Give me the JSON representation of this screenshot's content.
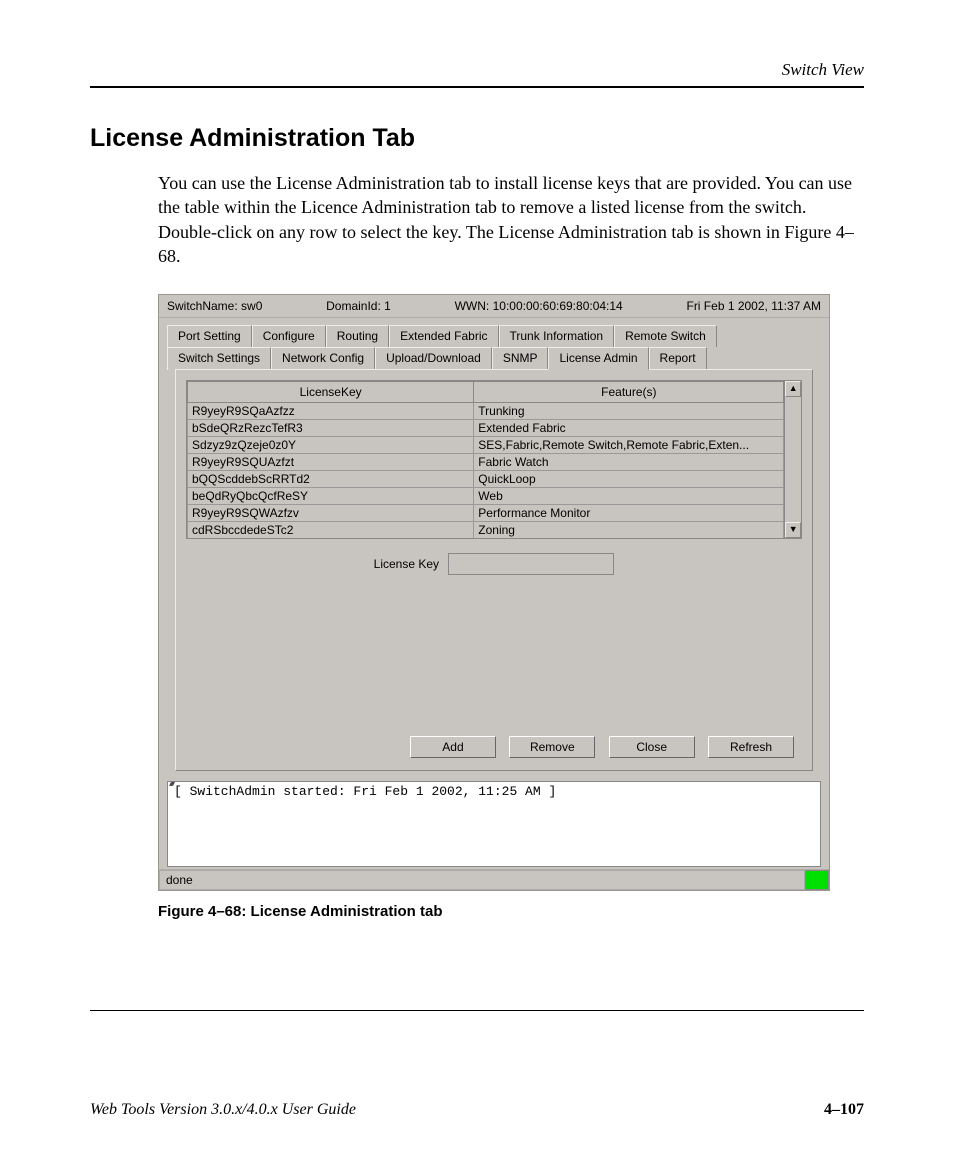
{
  "page_header": "Switch View",
  "heading": "License Administration Tab",
  "intro": "You can use the License Administration tab to install license keys that are provided. You can use the table within the Licence Administration tab to remove a listed license from the switch. Double-click on any row to select the key. The License Administration tab is shown in Figure 4–68.",
  "info_bar": {
    "switch_name_label": "SwitchName:",
    "switch_name_value": "sw0",
    "domain_label": "DomainId:",
    "domain_value": "1",
    "wwn_label": "WWN:",
    "wwn_value": "10:00:00:60:69:80:04:14",
    "datetime": "Fri Feb 1  2002, 11:37 AM"
  },
  "tabs_row1": [
    "Port Setting",
    "Configure",
    "Routing",
    "Extended Fabric",
    "Trunk Information",
    "Remote Switch"
  ],
  "tabs_row2": [
    "Switch Settings",
    "Network Config",
    "Upload/Download",
    "SNMP",
    "License Admin",
    "Report"
  ],
  "active_tab": "License Admin",
  "table": {
    "headers": [
      "LicenseKey",
      "Feature(s)"
    ],
    "rows": [
      {
        "key": "R9yeyR9SQaAzfzz",
        "feature": "Trunking"
      },
      {
        "key": "bSdeQRzRezcTefR3",
        "feature": "Extended Fabric"
      },
      {
        "key": "Sdzyz9zQzeje0z0Y",
        "feature": "SES,Fabric,Remote Switch,Remote Fabric,Exten..."
      },
      {
        "key": "R9yeyR9SQUAzfzt",
        "feature": "Fabric Watch"
      },
      {
        "key": "bQQScddebScRRTd2",
        "feature": "QuickLoop"
      },
      {
        "key": "beQdRyQbcQcfReSY",
        "feature": "Web"
      },
      {
        "key": "R9yeyR9SQWAzfzv",
        "feature": "Performance Monitor"
      },
      {
        "key": "cdRSbccdedeSTc2",
        "feature": "Zoning"
      }
    ]
  },
  "license_key_label": "License Key",
  "license_key_value": "",
  "buttons": {
    "add": "Add",
    "remove": "Remove",
    "close": "Close",
    "refresh": "Refresh"
  },
  "console_text": "[ SwitchAdmin started: Fri Feb 1  2002, 11:25 AM ]",
  "status_text": "done",
  "caption": "Figure 4–68:  License Administration tab",
  "footer_left": "Web Tools Version 3.0.x/4.0.x User Guide",
  "footer_right": "4–107"
}
